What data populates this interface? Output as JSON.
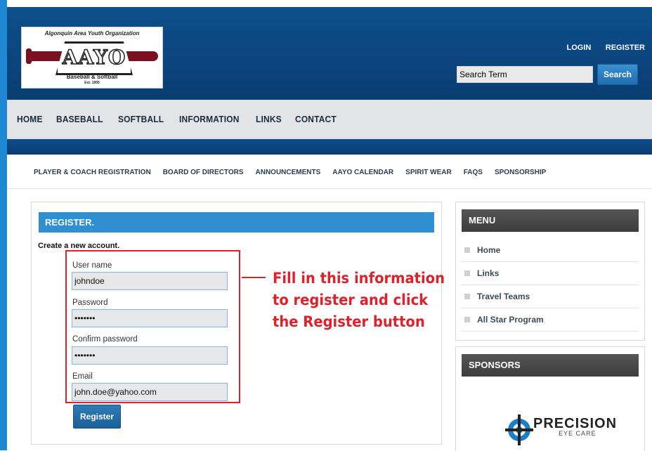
{
  "logo": {
    "org_name": "Algonquin Area Youth Organization",
    "letters": "AAYO",
    "subtitle": "Baseball & Softball",
    "established": "Est. 1955"
  },
  "header": {
    "login_label": "LOGIN",
    "register_label": "REGISTER",
    "search_value": "Search Term",
    "search_button": "Search"
  },
  "main_nav": [
    "HOME",
    "BASEBALL",
    "SOFTBALL",
    "INFORMATION",
    "LINKS",
    "CONTACT"
  ],
  "sub_nav": [
    "PLAYER & COACH REGISTRATION",
    "BOARD OF DIRECTORS",
    "ANNOUNCEMENTS",
    "AAYO CALENDAR",
    "SPIRIT WEAR",
    "FAQS",
    "SPONSORSHIP"
  ],
  "register": {
    "title": "REGISTER.",
    "intro": "Create a new account.",
    "username_label": "User name",
    "username_value": "johndoe",
    "password_label": "Password",
    "password_value": "•••••••",
    "confirm_label": "Confirm password",
    "confirm_value": "•••••••",
    "email_label": "Email",
    "email_value": "john.doe@yahoo.com",
    "button_label": "Register"
  },
  "callout": {
    "line1": "Fill in this information",
    "line2": "to register and click",
    "line3": "the Register button"
  },
  "side_menu": {
    "title": "MENU",
    "items": [
      "Home",
      "Links",
      "Travel Teams",
      "All Star Program"
    ]
  },
  "sponsors": {
    "title": "SPONSORS",
    "sponsor_name": "PRECISION",
    "sponsor_sub": "EYE CARE"
  },
  "colors": {
    "header_blue": "#0e4f8c",
    "accent_blue": "#2f8fd0",
    "callout_red": "#e0202a"
  }
}
